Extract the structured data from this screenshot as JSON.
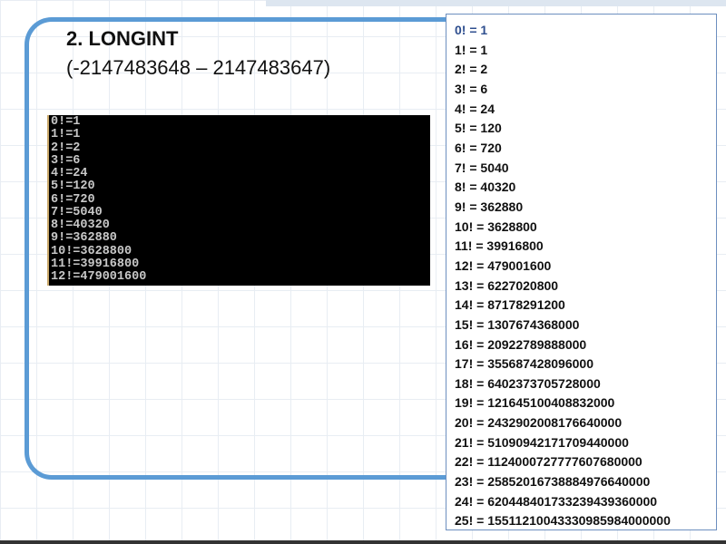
{
  "slide": {
    "title": "2. LONGINT",
    "range": "(-2147483648 – 2147483647)"
  },
  "console_output": [
    "0!=1",
    "1!=1",
    "2!=2",
    "3!=6",
    "4!=24",
    "5!=120",
    "6!=720",
    "7!=5040",
    "8!=40320",
    "9!=362880",
    "10!=3628800",
    "11!=39916800",
    "12!=479001600"
  ],
  "factorial_list": [
    "0! = 1",
    "1! = 1",
    "2! = 2",
    "3! = 6",
    "4! = 24",
    "5! = 120",
    "6! = 720",
    "7! = 5040",
    "8! = 40320",
    "9! = 362880",
    "10! = 3628800",
    "11! = 39916800",
    "12! = 479001600",
    "13! = 6227020800",
    "14! = 87178291200",
    "15! = 1307674368000",
    "16! = 20922789888000",
    "17! = 355687428096000",
    "18! = 6402373705728000",
    "19! = 121645100408832000",
    "20! = 2432902008176640000",
    "21! = 51090942171709440000",
    "22! = 1124000727777607680000",
    "23! = 25852016738884976640000",
    "24! = 620448401733239439360000",
    "25! = 15511210043330985984000000"
  ],
  "colors": {
    "frame": "#5b9bd5",
    "panel_border": "#6d8fbf",
    "console_bg": "#000000"
  }
}
